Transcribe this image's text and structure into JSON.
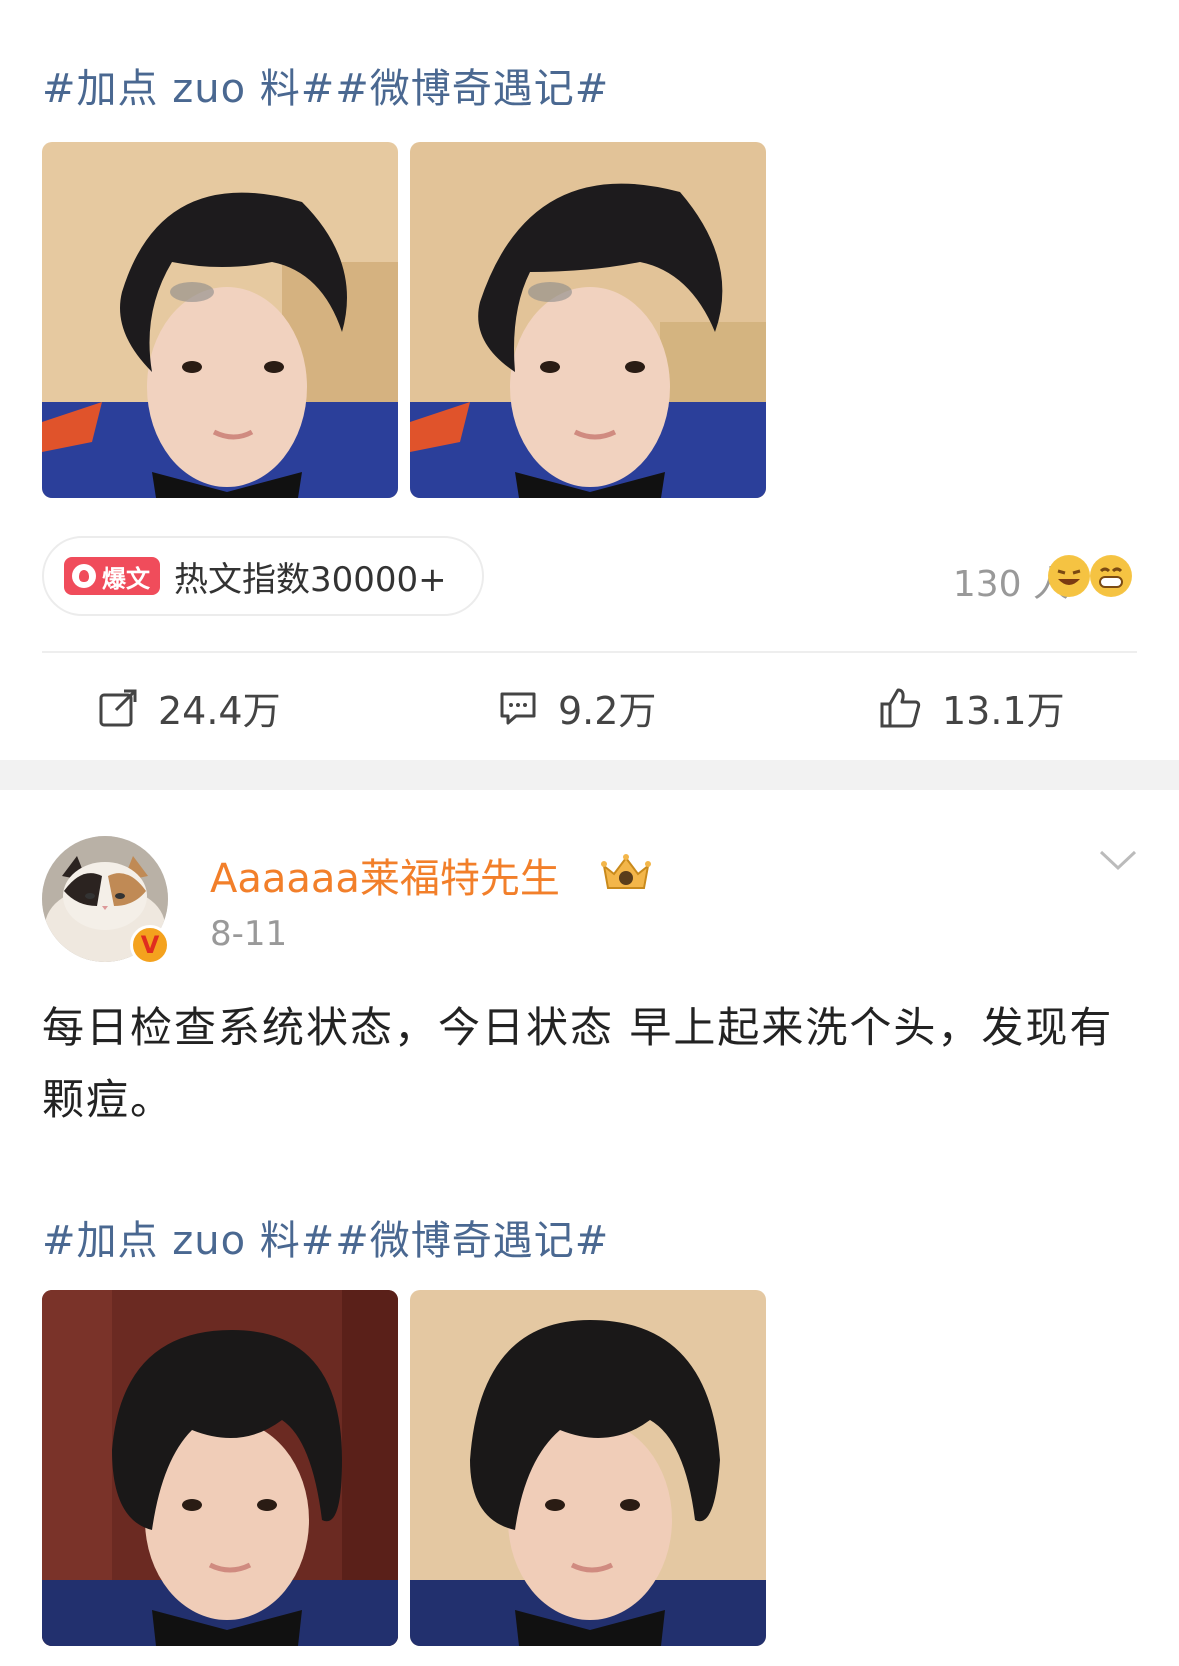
{
  "post1": {
    "hashtags": "#加点 zuo 料##微博奇遇记#",
    "hot_badge": "爆文",
    "hot_index": "热文指数30000+",
    "people_count": "130 人",
    "actions": {
      "repost": "24.4万",
      "comment": "9.2万",
      "like": "13.1万"
    }
  },
  "post2": {
    "username": "Aaaaaa莱福特先生",
    "date": "8-11",
    "verified_mark": "V",
    "text": "每日检查系统状态，今日状态 早上起来洗个头，发现有颗痘。",
    "hashtags": "#加点 zuo 料##微博奇遇记#"
  },
  "colors": {
    "hashtag": "#4a6891",
    "username": "#f27f2a",
    "hot_badge": "#f04c5b",
    "muted": "#999999"
  },
  "icons": [
    "repost-icon",
    "comment-icon",
    "like-icon",
    "chevron-down-icon",
    "crown-icon",
    "verified-icon"
  ]
}
